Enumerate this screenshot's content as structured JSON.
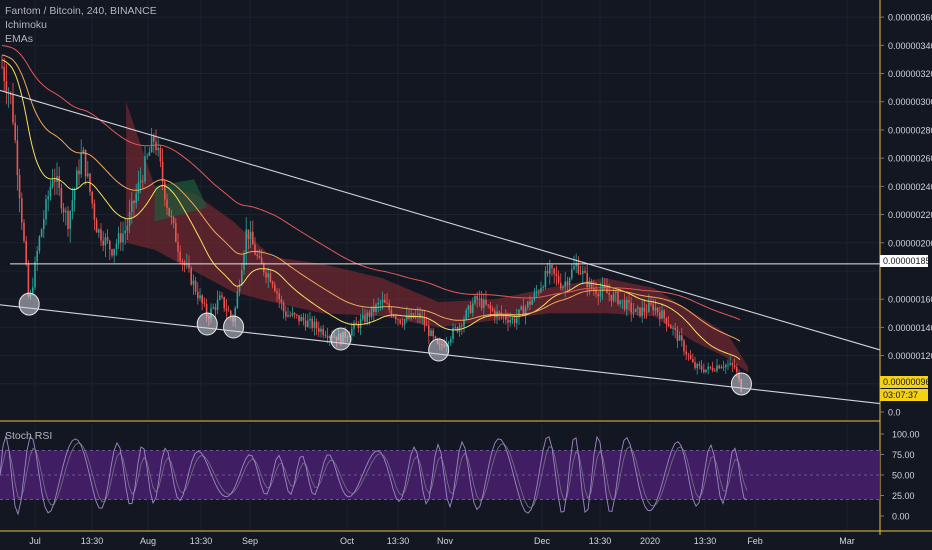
{
  "legend": {
    "symbol": "Fantom / Bitcoin, 240, BINANCE",
    "ind1": "Ichimoku",
    "ind2": "EMAs",
    "rsi": "Stoch RSI"
  },
  "colors": {
    "background": "#131722",
    "grid": "#1e222d",
    "up": "#26a69a",
    "down": "#ef5350",
    "trendline": "#d1d4dc",
    "axis_line": "#ebc23a",
    "cloud_bear": "#8e2b33",
    "cloud_bull": "#1f5a3a",
    "rsi_band": "#4a1f6e",
    "rsi_k": "#9f87c9",
    "rsi_d": "#6b6f7a",
    "badge_price_bg": "#f5d312",
    "badge_line_bg": "#ffffff"
  },
  "chart_data": {
    "type": "line",
    "title": "Fantom / Bitcoin, 240, BINANCE",
    "x_ticks": [
      "Jul",
      "13:30",
      "Aug",
      "13:30",
      "Sep",
      "Oct",
      "13:30",
      "Nov",
      "Dec",
      "13:30",
      "2020",
      "13:30",
      "Feb",
      "Mar"
    ],
    "y_ticks": [
      "0.00000360",
      "0.00000340",
      "0.00000320",
      "0.00000300",
      "0.00000280",
      "0.00000260",
      "0.00000240",
      "0.00000220",
      "0.00000200",
      "0.00000160",
      "0.00000140",
      "0.00000120",
      "0.0"
    ],
    "ylim": [
      8e-07,
      3.7e-06
    ],
    "price_series": {
      "points": [
        [
          "Jun 20",
          3.3e-06
        ],
        [
          "Jun 24",
          3e-06
        ],
        [
          "Jun 27",
          2.3e-06
        ],
        [
          "Jun 30",
          1.55e-06
        ],
        [
          "Jul 2",
          2e-06
        ],
        [
          "Jul 6",
          2.5e-06
        ],
        [
          "Jul 10",
          2.15e-06
        ],
        [
          "Jul 14",
          2.65e-06
        ],
        [
          "Jul 18",
          2.1e-06
        ],
        [
          "Jul 22",
          1.95e-06
        ],
        [
          "Jul 26",
          2.1e-06
        ],
        [
          "Jul 30",
          2.45e-06
        ],
        [
          "Aug 3",
          2.75e-06
        ],
        [
          "Aug 7",
          2.25e-06
        ],
        [
          "Aug 11",
          1.9e-06
        ],
        [
          "Aug 15",
          1.7e-06
        ],
        [
          "Aug 19",
          1.48e-06
        ],
        [
          "Aug 23",
          1.6e-06
        ],
        [
          "Aug 27",
          1.45e-06
        ],
        [
          "Aug 31",
          2.1e-06
        ],
        [
          "Sep 4",
          1.85e-06
        ],
        [
          "Sep 8",
          1.75e-06
        ],
        [
          "Sep 12",
          1.5e-06
        ],
        [
          "Sep 18",
          1.45e-06
        ],
        [
          "Sep 24",
          1.38e-06
        ],
        [
          "Sep 30",
          1.32e-06
        ],
        [
          "Oct 6",
          1.45e-06
        ],
        [
          "Oct 12",
          1.58e-06
        ],
        [
          "Oct 18",
          1.45e-06
        ],
        [
          "Oct 24",
          1.48e-06
        ],
        [
          "Oct 30",
          1.25e-06
        ],
        [
          "Nov 5",
          1.4e-06
        ],
        [
          "Nov 11",
          1.6e-06
        ],
        [
          "Nov 17",
          1.5e-06
        ],
        [
          "Nov 23",
          1.45e-06
        ],
        [
          "Nov 29",
          1.6e-06
        ],
        [
          "Dec 3",
          1.8e-06
        ],
        [
          "Dec 7",
          1.7e-06
        ],
        [
          "Dec 11",
          1.85e-06
        ],
        [
          "Dec 15",
          1.68e-06
        ],
        [
          "Dec 19",
          1.65e-06
        ],
        [
          "Dec 23",
          1.6e-06
        ],
        [
          "Dec 28",
          1.5e-06
        ],
        [
          "Jan 2",
          1.55e-06
        ],
        [
          "Jan 6",
          1.45e-06
        ],
        [
          "Jan 10",
          1.3e-06
        ],
        [
          "Jan 14",
          1.12e-06
        ],
        [
          "Jan 18",
          1.1e-06
        ],
        [
          "Jan 22",
          1.14e-06
        ],
        [
          "Jan 26",
          1.12e-06
        ],
        [
          "Jan 28",
          9.6e-07
        ]
      ]
    },
    "upper_trendline": [
      [
        "Jun 20",
        3.08e-06
      ],
      [
        "Mar 12",
        1.24e-06
      ]
    ],
    "lower_trendline": [
      [
        "Jun 20",
        1.56e-06
      ],
      [
        "Mar 12",
        8.6e-07
      ]
    ],
    "horizontal_level": 1.85e-06,
    "last_price": 9.6e-07,
    "countdown": "03:07:37",
    "level_label": "0.00000185",
    "stoch_rsi": {
      "y_ticks": [
        "100.00",
        "75.00",
        "50.00",
        "25.00",
        "0.00"
      ],
      "band": [
        20,
        80
      ],
      "ylim": [
        0,
        100
      ]
    }
  }
}
